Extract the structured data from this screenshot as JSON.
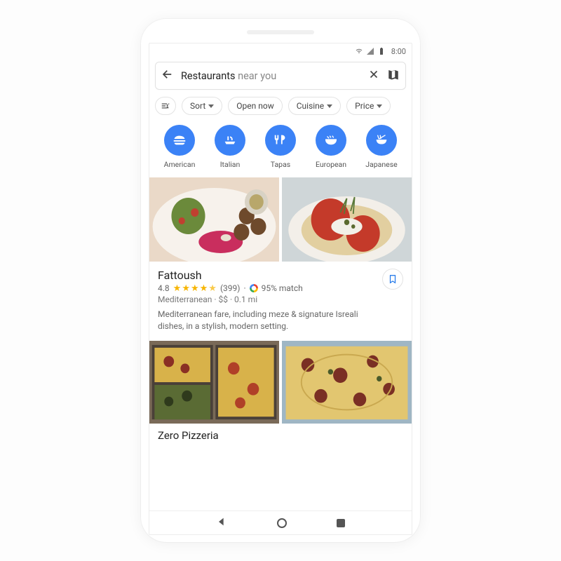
{
  "status": {
    "time": "8:00"
  },
  "search": {
    "term": "Restaurants",
    "suffix": "near you"
  },
  "filters": {
    "sort": "Sort",
    "open": "Open now",
    "cuisine": "Cuisine",
    "price": "Price"
  },
  "categories": [
    {
      "label": "American",
      "icon": "burger"
    },
    {
      "label": "Italian",
      "icon": "plate"
    },
    {
      "label": "Tapas",
      "icon": "tapas"
    },
    {
      "label": "European",
      "icon": "bowl"
    },
    {
      "label": "Japanese",
      "icon": "ramen"
    }
  ],
  "listing": {
    "name": "Fattoush",
    "rating": "4.8",
    "reviews": "(399)",
    "match": "95% match",
    "meta": "Mediterranean · $$ · 0.1 mi",
    "desc": "Mediterranean fare, including meze & signature Isreali dishes, in a stylish, modern setting."
  },
  "listing2": {
    "name": "Zero Pizzeria"
  }
}
